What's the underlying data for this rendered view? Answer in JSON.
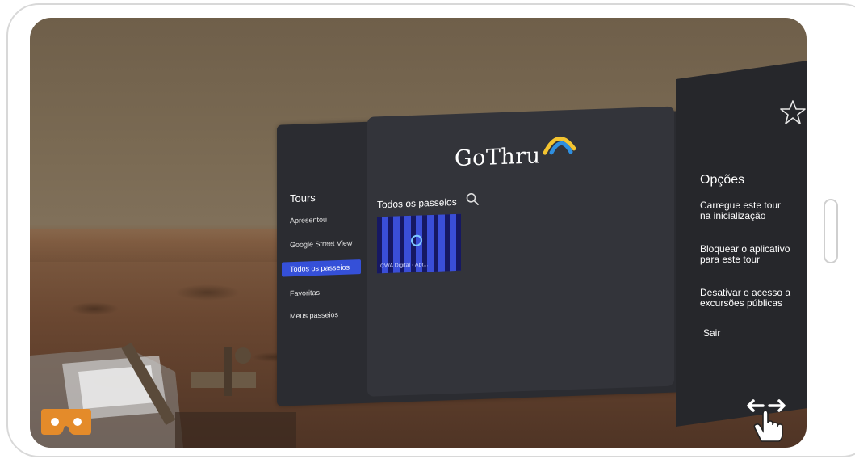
{
  "logo": {
    "text": "GoThru"
  },
  "sidebar": {
    "title": "Tours",
    "items": [
      {
        "label": "Apresentou"
      },
      {
        "label": "Google Street View"
      },
      {
        "label": "Todos os passeios"
      },
      {
        "label": "Favoritas"
      },
      {
        "label": "Meus passeios"
      }
    ]
  },
  "main": {
    "section_title": "Todos os passeios",
    "tour_card": {
      "caption": "CWA Digital - Apt..."
    }
  },
  "options": {
    "title": "Opções",
    "items": [
      {
        "label": "Carregue este tour\nna inicialização"
      },
      {
        "label": "Bloquear o aplicativo\npara este tour"
      },
      {
        "label": "Desativar o acesso a\nexcursões públicas"
      },
      {
        "label": "Sair"
      }
    ]
  },
  "icons": {
    "favorite": "star-icon",
    "vr_mode": "cardboard-icon",
    "pan_gesture": "drag-hand-icon",
    "search": "search-icon"
  },
  "colors": {
    "accent": "#3550d8",
    "panel_bg": "#2b2c31",
    "vr_icon": "#e48b2a",
    "logo_arc_yellow": "#f4c430",
    "logo_arc_blue": "#2f8fe0"
  }
}
